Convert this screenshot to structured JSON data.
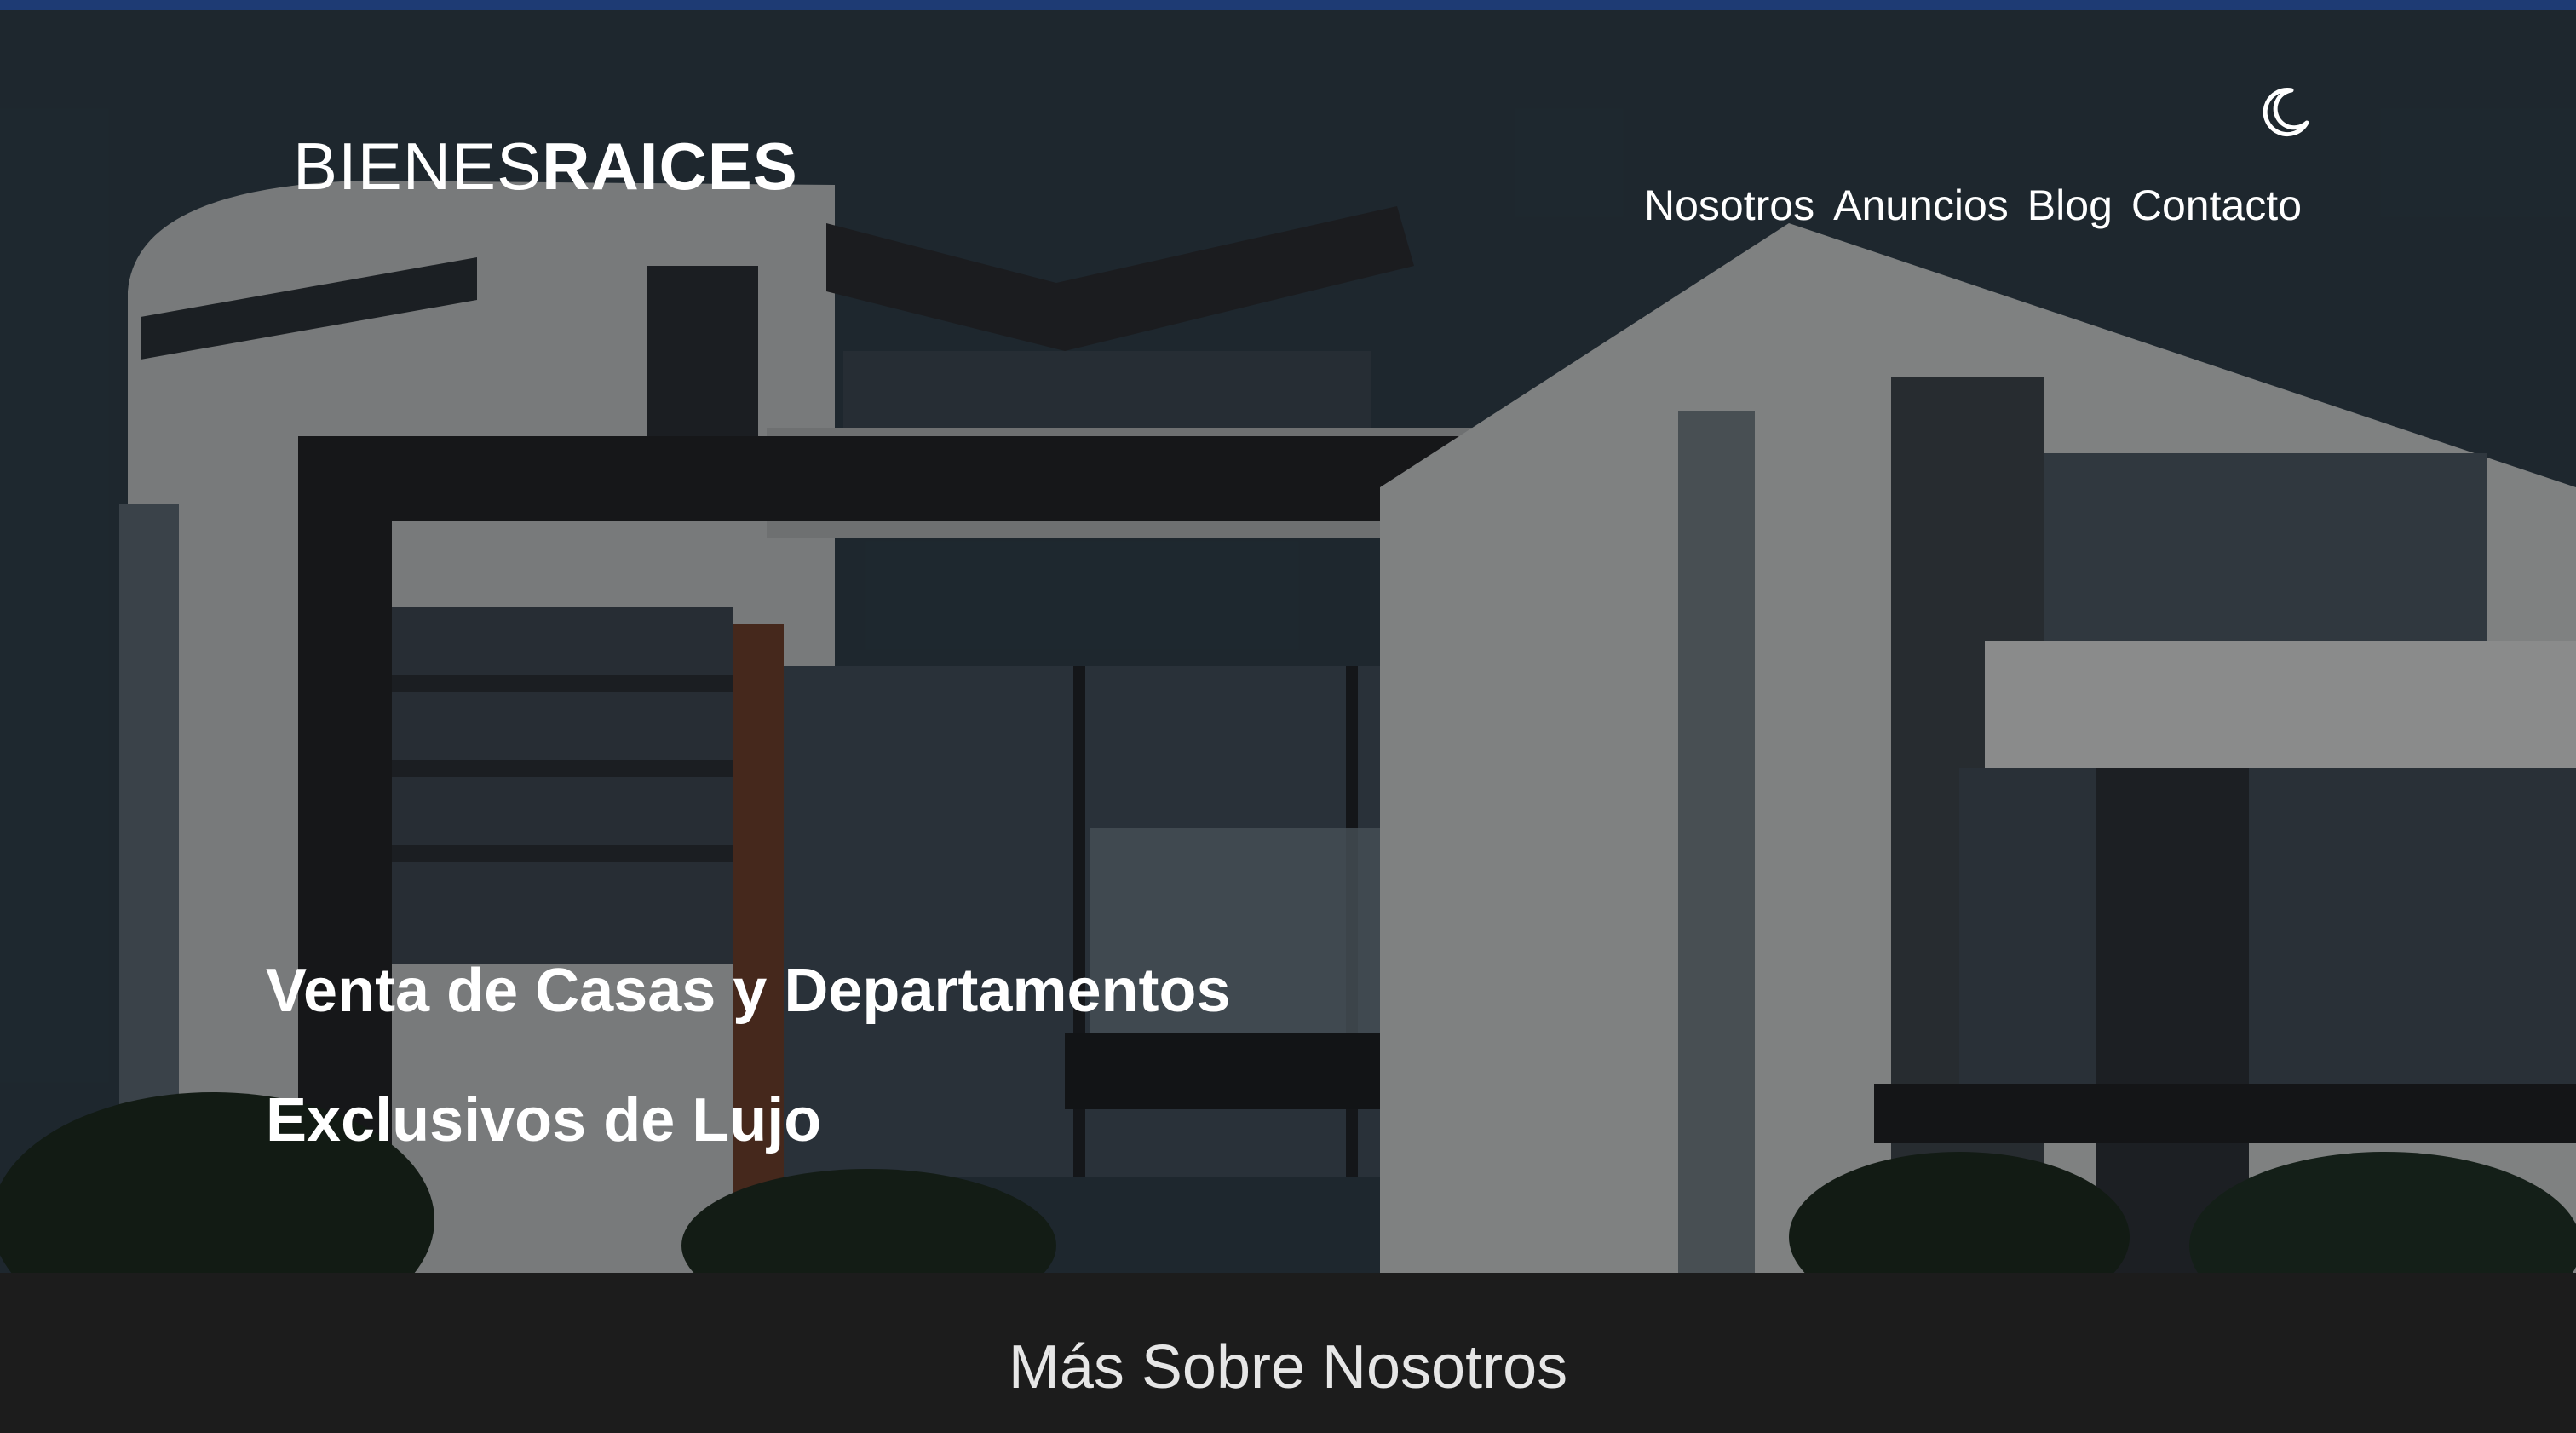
{
  "brand": {
    "logo_thin": "BIENES",
    "logo_bold": "RAICES"
  },
  "header": {
    "theme_toggle_icon": "moon-icon"
  },
  "nav": {
    "items": [
      {
        "label": "Nosotros"
      },
      {
        "label": "Anuncios"
      },
      {
        "label": "Blog"
      },
      {
        "label": "Contacto"
      }
    ]
  },
  "hero": {
    "title_line1": "Venta de Casas y Departamentos",
    "title_line2": "Exclusivos de Lujo",
    "background": "modern-house-photo"
  },
  "section": {
    "title": "Más Sobre Nosotros"
  },
  "colors": {
    "topbar": "#1e3b74",
    "section_bg": "#1c1c1c",
    "text": "#ffffff"
  }
}
